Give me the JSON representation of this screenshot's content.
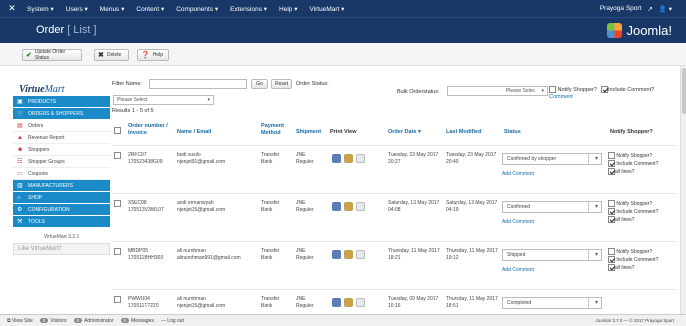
{
  "topnav": {
    "menus": [
      "System ▾",
      "Users ▾",
      "Menus ▾",
      "Content ▾",
      "Components ▾",
      "Extensions ▾",
      "Help ▾",
      "VirtueMart ▾"
    ],
    "site_link": "Prayoga Sport",
    "user_icon": "user-icon"
  },
  "header": {
    "title_main": "Order",
    "title_sub": "[ List ]",
    "logo_text": "Joomla!"
  },
  "toolbar": {
    "update_status": "Update Order Status",
    "delete": "Delete",
    "help": "Help"
  },
  "sidebar": {
    "brand_a": "Virtue",
    "brand_b": "Mart",
    "items": [
      {
        "label": "PRODUCTS",
        "style": "blue",
        "icon": "box-icon"
      },
      {
        "label": "ORDERS & SHOPPERS",
        "style": "blue",
        "icon": "cart-icon"
      },
      {
        "label": "Orders",
        "style": "white",
        "icon": "document-icon"
      },
      {
        "label": "Revenue Report",
        "style": "white",
        "icon": "chart-icon"
      },
      {
        "label": "Shoppers",
        "style": "white",
        "icon": "users-icon"
      },
      {
        "label": "Shopper Groups",
        "style": "white",
        "icon": "group-icon"
      },
      {
        "label": "Coupons",
        "style": "white",
        "icon": "coupon-icon"
      },
      {
        "label": "MANUFACTURERS",
        "style": "blue",
        "icon": "factory-icon"
      },
      {
        "label": "SHOP",
        "style": "blue",
        "icon": "shop-icon"
      },
      {
        "label": "CONFIGURATION",
        "style": "blue",
        "icon": "wrench-icon"
      },
      {
        "label": "TOOLS",
        "style": "blue",
        "icon": "tools-icon"
      }
    ],
    "version": "VirtueMart 3.2.1",
    "like_text": "Like VirtueMart?"
  },
  "filter": {
    "name_label": "Filter Name:",
    "name_value": "",
    "go": "Go",
    "reset": "Reset",
    "status_label": "Order Status:",
    "select_value": "Please Select",
    "results": "Results 1 - 5 of 5",
    "bulk_label": "Bulk Orderstatus:",
    "bulk_select": "Please Selec",
    "notify_label": "Notify Shopper?",
    "include_label": "Include Comment?",
    "comment_link": "Comment"
  },
  "table": {
    "headers": {
      "order": "Order number / Invoice",
      "name": "Name / Email",
      "payment": "Payment Method",
      "shipment": "Shipment",
      "print": "Print View",
      "date": "Order Date ▾",
      "modified": "Last Modified",
      "status": "Status",
      "notify": "Notify Shopper?"
    },
    "rows": [
      {
        "order": "2RFC07",
        "invoice": "170523438G09",
        "name": "budi susilo",
        "email": "njenjet91@gmail.com",
        "payment": "Transfer Bank",
        "shipment": "JNE Reguler",
        "date": "Tuesday, 23 May 2017 20:27",
        "modified": "Tuesday, 23 May 2017 20:40",
        "status": "Confirmed by shopper",
        "add_comment": "Add Comment",
        "notify": "Notify Shopper?",
        "include": "Include Comment?",
        "all_lines": "all lines?"
      },
      {
        "order": "X5EC08",
        "invoice": "170513V3WL07",
        "name": "andi ermanwyah",
        "email": "njenjet15@gmail.com",
        "payment": "Transfer Bank",
        "shipment": "JNE Reguler",
        "date": "Saturday, 13 May 2017 04:08",
        "modified": "Saturday, 13 May 2017 04:19",
        "status": "Confirmed",
        "add_comment": "Add Comment",
        "notify": "Notify Shopper?",
        "include": "Include Comment?",
        "all_lines": "all lines?"
      },
      {
        "order": "MBDP05",
        "invoice": "170511BHH303",
        "name": "ali nurohman",
        "email": "alinurohman991@gmail.com",
        "payment": "Transfer Bank",
        "shipment": "JNE Reguler",
        "date": "Thursday, 11 May 2017 18:21",
        "modified": "Thursday, 11 May 2017 19:12",
        "status": "Shipped",
        "add_comment": "Add Comment",
        "notify": "Notify Shopper?",
        "include": "Include Comment?",
        "all_lines": "all lines?"
      },
      {
        "order": "PWWU04",
        "invoice": "170511T7220",
        "name": "ali nurohman",
        "email": "njenjet15@gmail.com",
        "payment": "Transfer Bank",
        "shipment": "JNE Reguler",
        "date": "Tuesday, 09 May 2017 10:16",
        "modified": "Thursday, 11 May 2017 18:51",
        "status": "Completed",
        "add_comment": "",
        "notify": "",
        "include": "",
        "all_lines": ""
      }
    ]
  },
  "footer": {
    "view_site": "View Site",
    "visitors_count": "0",
    "visitors": "Visitors",
    "admin_count": "0",
    "admin": "Administrator",
    "messages_count": "0",
    "messages": "Messages",
    "logout": "Log out",
    "copyright": "Joomla! 3.7.0 — © 2017 Prayoga Sport"
  },
  "colors": {
    "nav": "#1a3867",
    "accent": "#1a8ac8",
    "link": "#136ba6"
  }
}
